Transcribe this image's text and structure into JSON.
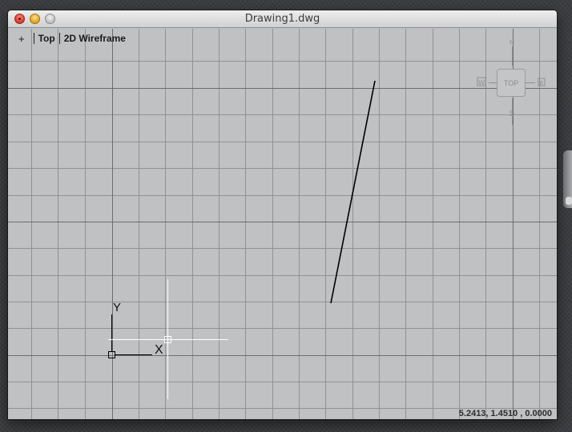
{
  "window": {
    "title": "Drawing1.dwg"
  },
  "viewport_controls": {
    "plus_label": "+",
    "view_label": "Top",
    "visual_style_label": "2D Wireframe"
  },
  "viewcube": {
    "face_label": "TOP",
    "compass_n": "N",
    "compass_s": "S",
    "compass_w": "W",
    "compass_e": "E"
  },
  "ucs_icon": {
    "x_label": "X",
    "y_label": "Y"
  },
  "status": {
    "coordinates": "5.2413,  1.4510 , 0.0000"
  },
  "colors": {
    "canvas_bg": "#c0c1c3",
    "grid_minor": "#8f9194",
    "grid_major": "#6a6c70",
    "line": "#000000",
    "crosshair": "#ffffff"
  }
}
